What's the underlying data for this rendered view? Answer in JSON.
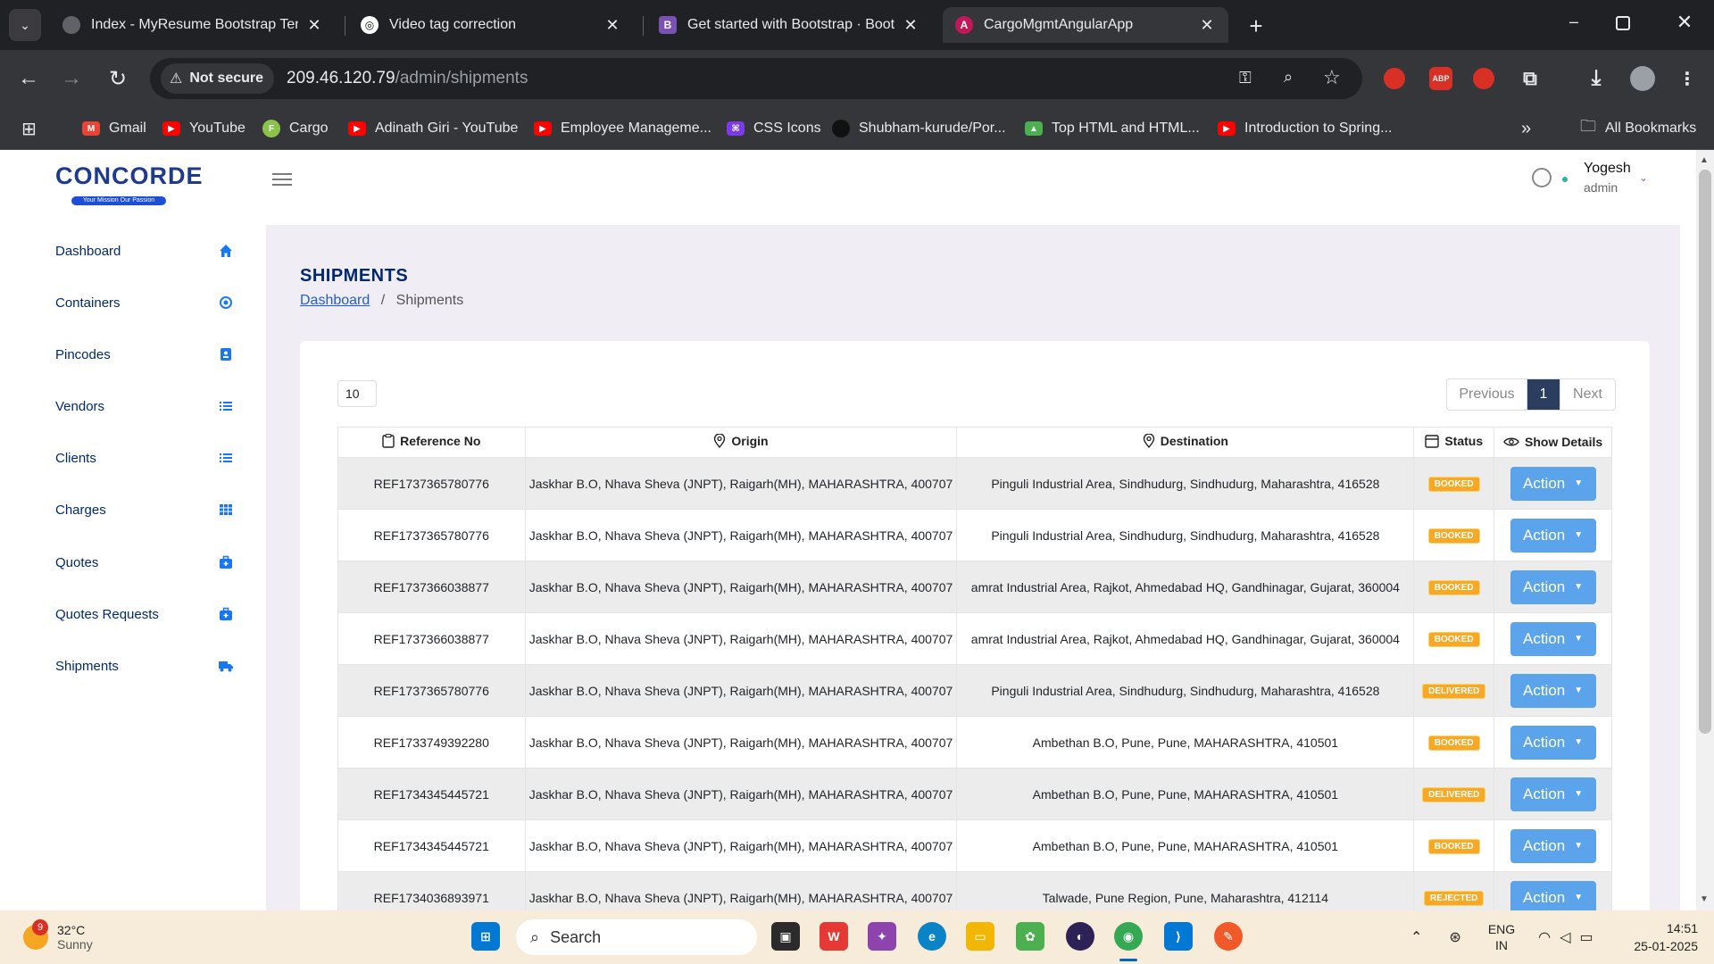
{
  "tabs": [
    {
      "title": "Index - MyResume Bootstrap Temp",
      "active": false
    },
    {
      "title": "Video tag correction",
      "active": false
    },
    {
      "title": "Get started with Bootstrap · Bootst",
      "active": false
    },
    {
      "title": "CargoMgmtAngularApp",
      "active": true
    }
  ],
  "toolbar": {
    "security_label": "Not secure",
    "url_host": "209.46.120.79",
    "url_path": "/admin/shipments"
  },
  "bookmarks": [
    "Gmail",
    "YouTube",
    "Cargo",
    "Adinath Giri - YouTube",
    "Employee Manageme...",
    "CSS Icons",
    "Shubham-kurude/Por...",
    "Top HTML and HTML...",
    "Introduction to Spring..."
  ],
  "bookmarks_all": "All Bookmarks",
  "logo": {
    "word": "CONCORDE",
    "tagline": "Your Mission Our Passion"
  },
  "sidebar": {
    "items": [
      {
        "label": "Dashboard",
        "icon": "home-icon"
      },
      {
        "label": "Containers",
        "icon": "target-icon"
      },
      {
        "label": "Pincodes",
        "icon": "contact-card-icon"
      },
      {
        "label": "Vendors",
        "icon": "list-icon"
      },
      {
        "label": "Clients",
        "icon": "list-icon"
      },
      {
        "label": "Charges",
        "icon": "grid-icon"
      },
      {
        "label": "Quotes",
        "icon": "briefcase-plus-icon"
      },
      {
        "label": "Quotes Requests",
        "icon": "briefcase-plus-icon"
      },
      {
        "label": "Shipments",
        "icon": "truck-icon"
      }
    ]
  },
  "user": {
    "name": "Yogesh",
    "role": "admin"
  },
  "main": {
    "title": "SHIPMENTS",
    "breadcrumb_home": "Dashboard",
    "breadcrumb_sep": "/",
    "breadcrumb_current": "Shipments",
    "page_size": "10",
    "pager": {
      "prev": "Previous",
      "current": "1",
      "next": "Next"
    },
    "columns": [
      "Reference No",
      "Origin",
      "Destination",
      "Status",
      "Show Details"
    ],
    "action_label": "Action",
    "rows": [
      {
        "ref": "REF1737365780776",
        "origin": "Jaskhar B.O, Nhava Sheva (JNPT), Raigarh(MH), MAHARASHTRA, 400707",
        "destination": "Pinguli Industrial Area, Sindhudurg, Sindhudurg, Maharashtra, 416528",
        "status": "BOOKED"
      },
      {
        "ref": "REF1737365780776",
        "origin": "Jaskhar B.O, Nhava Sheva (JNPT), Raigarh(MH), MAHARASHTRA, 400707",
        "destination": "Pinguli Industrial Area, Sindhudurg, Sindhudurg, Maharashtra, 416528",
        "status": "BOOKED"
      },
      {
        "ref": "REF1737366038877",
        "origin": "Jaskhar B.O, Nhava Sheva (JNPT), Raigarh(MH), MAHARASHTRA, 400707",
        "destination": "amrat Industrial Area, Rajkot, Ahmedabad HQ, Gandhinagar, Gujarat, 360004",
        "status": "BOOKED"
      },
      {
        "ref": "REF1737366038877",
        "origin": "Jaskhar B.O, Nhava Sheva (JNPT), Raigarh(MH), MAHARASHTRA, 400707",
        "destination": "amrat Industrial Area, Rajkot, Ahmedabad HQ, Gandhinagar, Gujarat, 360004",
        "status": "BOOKED"
      },
      {
        "ref": "REF1737365780776",
        "origin": "Jaskhar B.O, Nhava Sheva (JNPT), Raigarh(MH), MAHARASHTRA, 400707",
        "destination": "Pinguli Industrial Area, Sindhudurg, Sindhudurg, Maharashtra, 416528",
        "status": "DELIVERED"
      },
      {
        "ref": "REF1733749392280",
        "origin": "Jaskhar B.O, Nhava Sheva (JNPT), Raigarh(MH), MAHARASHTRA, 400707",
        "destination": "Ambethan B.O, Pune, Pune, MAHARASHTRA, 410501",
        "status": "BOOKED"
      },
      {
        "ref": "REF1734345445721",
        "origin": "Jaskhar B.O, Nhava Sheva (JNPT), Raigarh(MH), MAHARASHTRA, 400707",
        "destination": "Ambethan B.O, Pune, Pune, MAHARASHTRA, 410501",
        "status": "DELIVERED"
      },
      {
        "ref": "REF1734345445721",
        "origin": "Jaskhar B.O, Nhava Sheva (JNPT), Raigarh(MH), MAHARASHTRA, 400707",
        "destination": "Ambethan B.O, Pune, Pune, MAHARASHTRA, 410501",
        "status": "BOOKED"
      },
      {
        "ref": "REF1734036893971",
        "origin": "Jaskhar B.O, Nhava Sheva (JNPT), Raigarh(MH), MAHARASHTRA, 400707",
        "destination": "Talwade, Pune Region, Pune, Maharashtra, 412114",
        "status": "REJECTED"
      }
    ]
  },
  "taskbar": {
    "weather_badge": "9",
    "temp": "32°C",
    "condition": "Sunny",
    "search_placeholder": "Search",
    "lang1": "ENG",
    "lang2": "IN",
    "time": "14:51",
    "date": "25-01-2025"
  },
  "colors": {
    "accent": "#5ba4ec",
    "nav_text": "#012970",
    "status_badge": "#f9a825",
    "pager_active": "#2c3e5f"
  }
}
